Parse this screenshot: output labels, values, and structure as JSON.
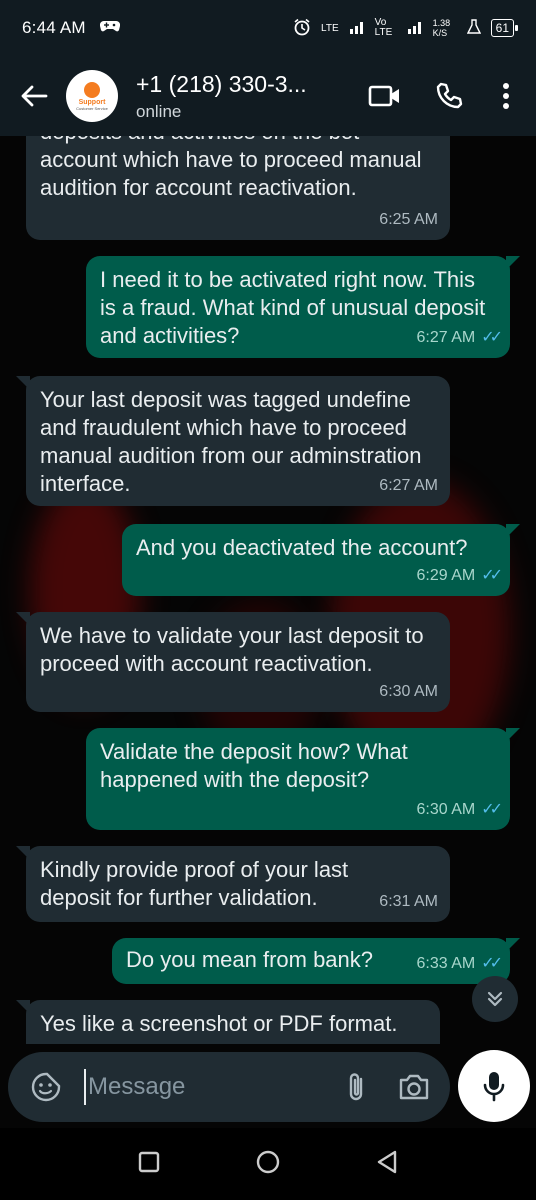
{
  "status_bar": {
    "time": "6:44 AM",
    "network_1": "LTE",
    "network_2": "Vo LTE",
    "speed": "1.38 K/S",
    "battery": "61"
  },
  "header": {
    "contact": "+1 (218) 330-3...",
    "status": "online",
    "avatar_text": "Support",
    "avatar_subtext": "Customer Service"
  },
  "messages": [
    {
      "direction": "in",
      "text": "deposits and activities on the bot account which have to proceed manual audition for account reactivation.",
      "time": "6:25 AM"
    },
    {
      "direction": "out",
      "text": "I need it to be activated right now. This is a fraud. What kind of unusual deposit and activities?",
      "time": "6:27 AM",
      "read": true
    },
    {
      "direction": "in",
      "text": "Your last deposit was tagged undefine and fraudulent which have to proceed manual audition from our adminstration interface.",
      "time": "6:27 AM"
    },
    {
      "direction": "out",
      "text": "And you deactivated the account?",
      "time": "6:29 AM",
      "read": true
    },
    {
      "direction": "in",
      "text": "We have to validate your last deposit to proceed with account reactivation.",
      "time": "6:30 AM"
    },
    {
      "direction": "out",
      "text": "Validate the deposit how? What happened with the deposit?",
      "time": "6:30 AM",
      "read": true
    },
    {
      "direction": "in",
      "text": "Kindly provide proof of your last deposit for further validation.",
      "time": "6:31 AM"
    },
    {
      "direction": "out",
      "text": "Do you mean from bank?",
      "time": "6:33 AM",
      "read": true
    },
    {
      "direction": "in",
      "text": "Yes like a screenshot or PDF format.",
      "time": ""
    }
  ],
  "composer": {
    "placeholder": "Message"
  },
  "colors": {
    "incoming_bubble": "#202c33",
    "outgoing_bubble": "#005c4b",
    "read_ticks": "#53bdeb",
    "header": "#111b21"
  }
}
